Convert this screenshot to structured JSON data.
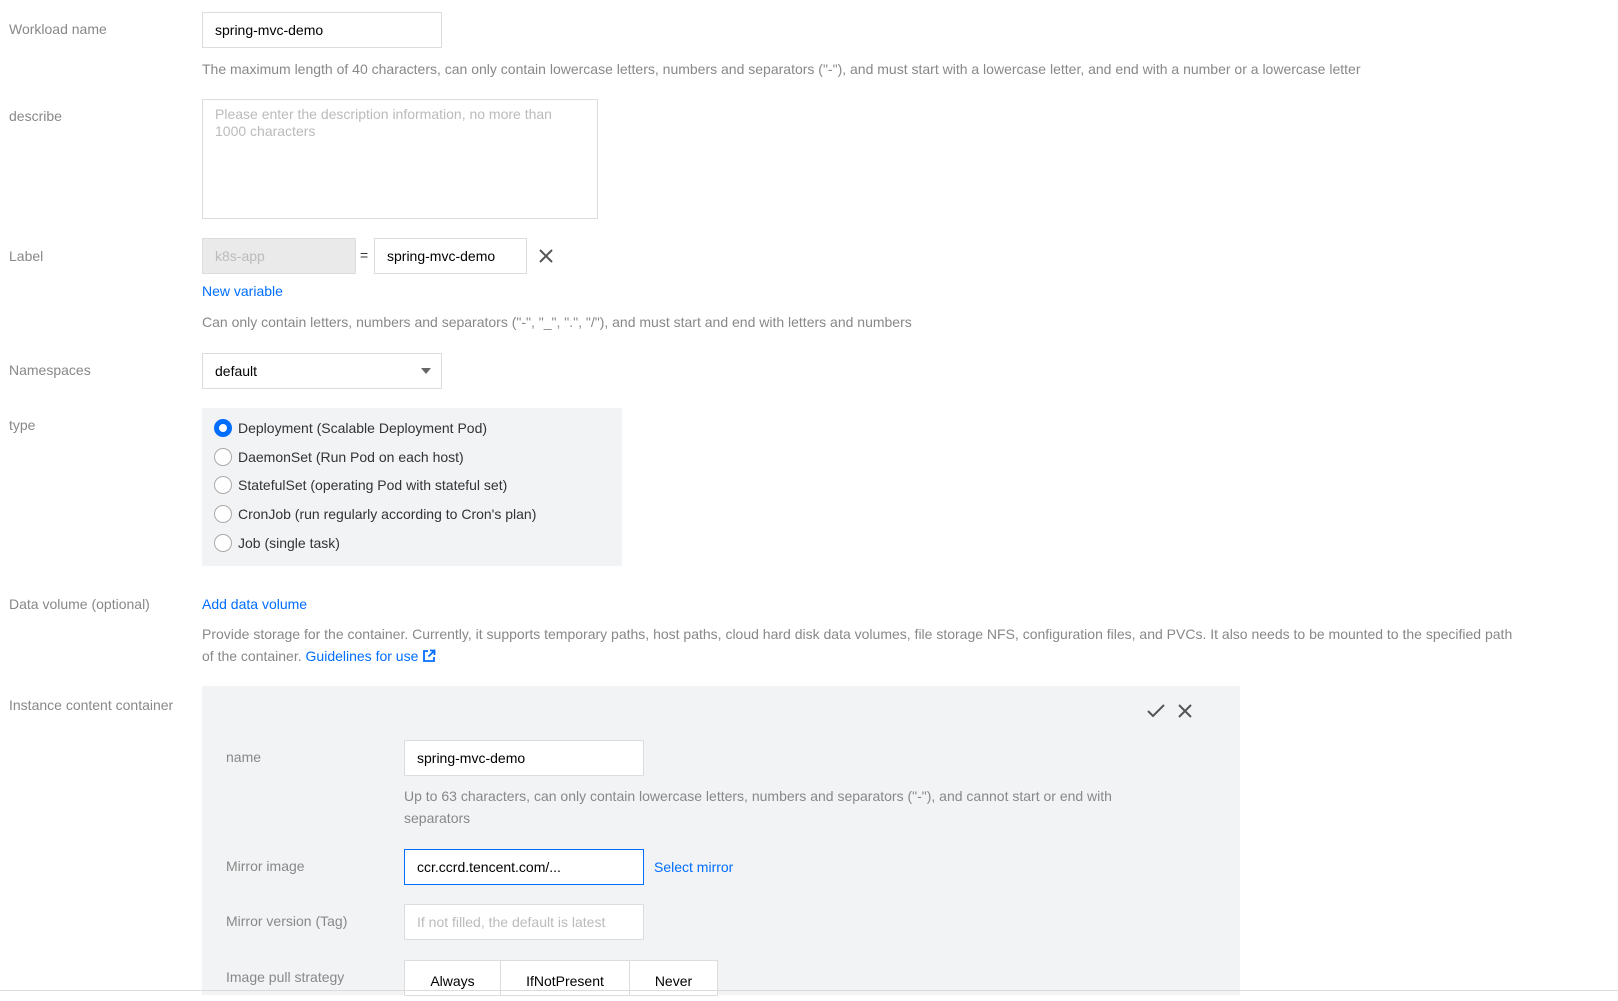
{
  "workload": {
    "label": "Workload name",
    "value": "spring-mvc-demo",
    "help": "The maximum length of 40 characters, can only contain lowercase letters, numbers and separators (\"-\"), and must start with a lowercase letter, and end with a number or a lowercase letter"
  },
  "describe": {
    "label": "describe",
    "placeholder": "Please enter the description information, no more than 1000 characters"
  },
  "labels": {
    "label": "Label",
    "key": "k8s-app",
    "equals": "=",
    "value": "spring-mvc-demo",
    "new_variable": "New variable",
    "help": "Can only contain letters, numbers and separators (\"-\", \"_\", \".\", \"/\"), and must start and end with letters and numbers"
  },
  "namespaces": {
    "label": "Namespaces",
    "selected": "default"
  },
  "type": {
    "label": "type",
    "options": [
      {
        "label": "Deployment (Scalable Deployment Pod)",
        "selected": true
      },
      {
        "label": "DaemonSet (Run Pod on each host)",
        "selected": false
      },
      {
        "label": "StatefulSet (operating Pod with stateful set)",
        "selected": false
      },
      {
        "label": "CronJob (run regularly according to Cron's plan)",
        "selected": false
      },
      {
        "label": "Job (single task)",
        "selected": false
      }
    ]
  },
  "data_volume": {
    "label": "Data volume (optional)",
    "add": "Add data volume",
    "help_line1": "Provide storage for the container. Currently, it supports temporary paths, host paths, cloud hard disk data volumes, file storage NFS, configuration files, and PVCs. It also needs to be mounted to the specified path",
    "help_line2": "of the container.",
    "guidelines": "Guidelines for use"
  },
  "container": {
    "label": "Instance content container",
    "name_label": "name",
    "name_value": "spring-mvc-demo",
    "name_help_line1": "Up to 63 characters, can only contain lowercase letters, numbers and separators (\"-\"), and cannot start or end with",
    "name_help_line2": "separators",
    "mirror_label": "Mirror image",
    "mirror_value": "ccr.ccrd.tencent.com/...",
    "select_mirror": "Select mirror",
    "tag_label": "Mirror version (Tag)",
    "tag_placeholder": "If not filled, the default is latest",
    "pull_label": "Image pull strategy",
    "pull_options": [
      "Always",
      "IfNotPresent",
      "Never"
    ]
  },
  "colors": {
    "accent": "#006eff",
    "label": "#888888",
    "panel": "#f2f3f5"
  }
}
